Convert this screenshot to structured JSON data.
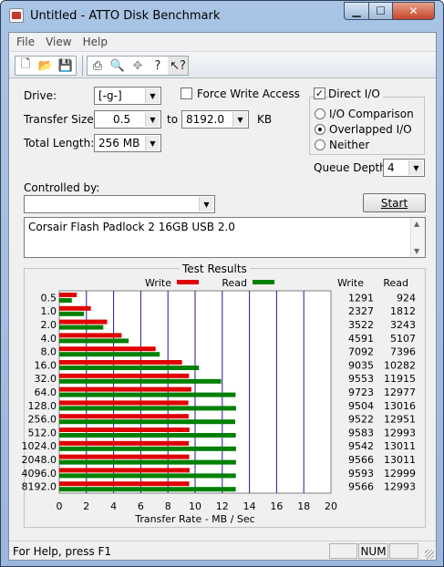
{
  "window": {
    "title": "Untitled - ATTO Disk Benchmark"
  },
  "menu": [
    "File",
    "View",
    "Help"
  ],
  "toolbar": {
    "icons": [
      "new-file-icon",
      "open-folder-icon",
      "save-icon",
      "print-icon",
      "print-preview-icon",
      "move-icon",
      "help-icon",
      "context-help-icon"
    ]
  },
  "form": {
    "drive_label": "Drive:",
    "drive_value": "[-g-]",
    "force_write_label": "Force Write Access",
    "force_write_checked": false,
    "direct_io_label": "Direct I/O",
    "direct_io_checked": true,
    "transfer_size_label": "Transfer Size:",
    "transfer_from": "0.5",
    "to_label": "to",
    "transfer_to": "8192.0",
    "kb_label": "KB",
    "total_length_label": "Total Length:",
    "total_length_value": "256 MB",
    "io_comparison_label": "I/O Comparison",
    "overlapped_io_label": "Overlapped I/O",
    "neither_label": "Neither",
    "selected_io_mode": "Overlapped I/O",
    "queue_depth_label": "Queue Depth:",
    "queue_depth_value": "4",
    "controlled_by_label": "Controlled by:",
    "controlled_by_value": "",
    "start_label": "Start",
    "description": "Corsair Flash Padlock 2 16GB USB 2.0"
  },
  "results": {
    "title": "Test Results",
    "write_legend": "Write",
    "read_legend": "Read",
    "write_header": "Write",
    "read_header": "Read"
  },
  "chart_data": {
    "type": "bar",
    "orientation": "horizontal",
    "categories": [
      "0.5",
      "1.0",
      "2.0",
      "4.0",
      "8.0",
      "16.0",
      "32.0",
      "64.0",
      "128.0",
      "256.0",
      "512.0",
      "1024.0",
      "2048.0",
      "4096.0",
      "8192.0"
    ],
    "series": [
      {
        "name": "Write",
        "color": "#e00000",
        "values": [
          1291,
          2327,
          3522,
          4591,
          7092,
          9035,
          9553,
          9723,
          9504,
          9522,
          9583,
          9542,
          9566,
          9593,
          9566
        ]
      },
      {
        "name": "Read",
        "color": "#008000",
        "values": [
          924,
          1812,
          3243,
          5107,
          7396,
          10282,
          11915,
          12977,
          13016,
          12951,
          12993,
          13011,
          13011,
          12999,
          12993
        ]
      }
    ],
    "value_unit": "KB/s",
    "xlabel": "Transfer Rate - MB / Sec",
    "xlim": [
      0,
      20
    ],
    "xticks": [
      "0",
      "2",
      "4",
      "6",
      "8",
      "10",
      "12",
      "14",
      "16",
      "18",
      "20"
    ],
    "grid": true,
    "legend": "top"
  },
  "status": {
    "text": "For Help, press F1",
    "num": "NUM"
  }
}
